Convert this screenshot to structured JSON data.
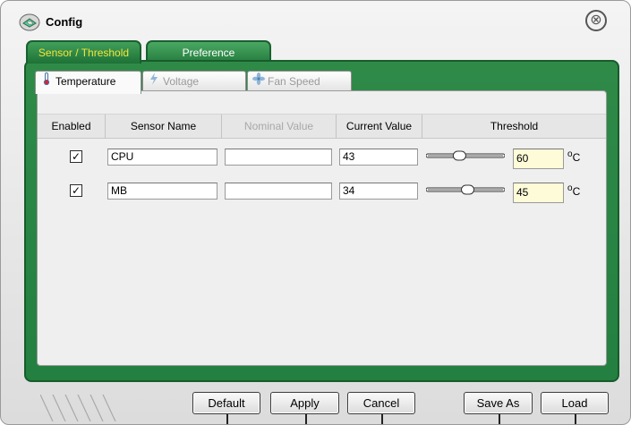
{
  "window": {
    "title": "Config",
    "close_glyph": "⊗"
  },
  "main_tabs": [
    {
      "label": "Sensor / Threshold",
      "active": true
    },
    {
      "label": "Preference",
      "active": false
    }
  ],
  "sub_tabs": [
    {
      "label": "Temperature",
      "icon": "thermometer-icon",
      "active": true
    },
    {
      "label": "Voltage",
      "icon": "voltage-icon",
      "active": false
    },
    {
      "label": "Fan Speed",
      "icon": "fan-icon",
      "active": false
    }
  ],
  "table": {
    "headers": {
      "enabled": "Enabled",
      "sensor_name": "Sensor Name",
      "nominal_value": "Nominal Value",
      "current_value": "Current Value",
      "threshold": "Threshold"
    },
    "rows": [
      {
        "enabled": true,
        "name": "CPU",
        "nominal": "",
        "current": "43",
        "threshold": "60",
        "slider_level": 0.4,
        "unit": "°C"
      },
      {
        "enabled": true,
        "name": "MB",
        "nominal": "",
        "current": "34",
        "threshold": "45",
        "slider_level": 0.52,
        "unit": "°C"
      }
    ]
  },
  "buttons": {
    "default": "Default",
    "apply": "Apply",
    "cancel": "Cancel",
    "save_as": "Save As",
    "load": "Load"
  },
  "colors": {
    "accent_green": "#238040",
    "active_tab_text": "#f3e53a",
    "threshold_field": "#fdfbd8"
  }
}
